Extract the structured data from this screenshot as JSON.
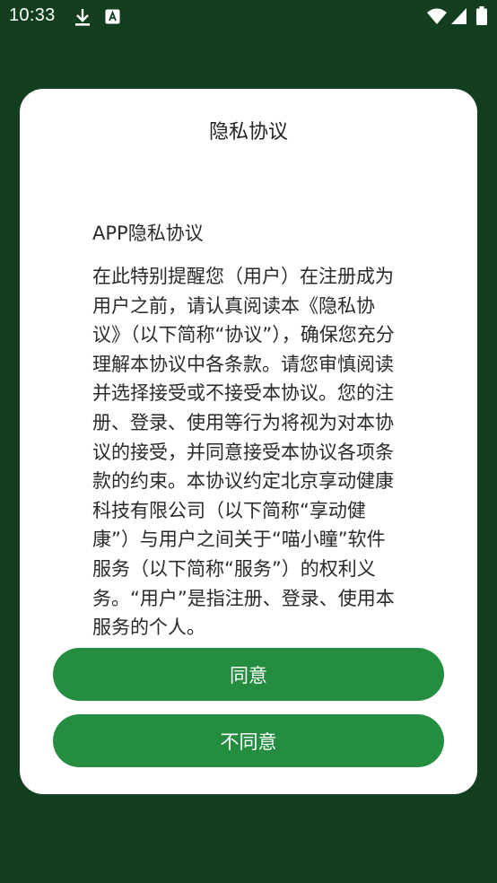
{
  "status_bar": {
    "time": "10:33",
    "icons": [
      "download-icon",
      "a-badge-icon",
      "wifi-icon",
      "signal-icon",
      "battery-icon"
    ]
  },
  "dialog": {
    "title": "隐私协议",
    "content_heading": "APP隐私协议",
    "content_body": "在此特别提醒您（用户）在注册成为用户之前，请认真阅读本《隐私协议》（以下简称“协议”），确保您充分理解本协议中各条款。请您审慎阅读并选择接受或不接受本协议。您的注册、登录、使用等行为将视为对本协议的接受，并同意接受本协议各项条款的约束。本协议约定北京享动健康科技有限公司（以下简称“享动健康”）与用户之间关于“喵小瞳”软件服务（以下简称“服务”）的权利义务。“用户”是指注册、登录、使用本服务的个人。",
    "agree_label": "同意",
    "disagree_label": "不同意"
  },
  "colors": {
    "background": "#133f1f",
    "accent": "#248d40",
    "dialog": "#ffffff"
  }
}
